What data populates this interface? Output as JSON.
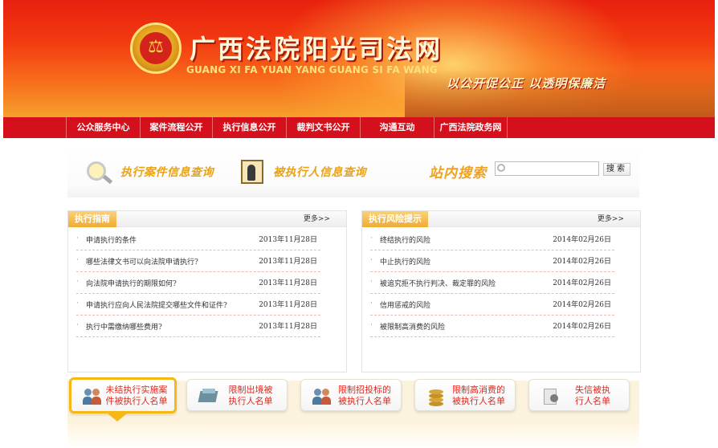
{
  "header": {
    "title": "广西法院阳光司法网",
    "pinyin": "GUANG XI FA YUAN YANG GUANG SI FA WANG",
    "slogan": "以公开促公正  以透明保廉洁"
  },
  "nav": {
    "items": [
      {
        "label": "公众服务中心"
      },
      {
        "label": "案件流程公开"
      },
      {
        "label": "执行信息公开"
      },
      {
        "label": "裁判文书公开"
      },
      {
        "label": "沟通互动"
      },
      {
        "label": "广西法院政务网"
      }
    ]
  },
  "quick_links": {
    "case_query": "执行案件信息查询",
    "person_query": "被执行人信息查询"
  },
  "search": {
    "label": "站内搜索",
    "placeholder": "",
    "button": "搜索"
  },
  "panels": {
    "guide": {
      "title": "执行指南",
      "more": "更多>>",
      "items": [
        {
          "title": "申请执行的条件",
          "date": "2013年11月28日"
        },
        {
          "title": "哪些法律文书可以向法院申请执行?",
          "date": "2013年11月28日"
        },
        {
          "title": "向法院申请执行的期限如何?",
          "date": "2013年11月28日"
        },
        {
          "title": "申请执行应向人民法院提交哪些文件和证件?",
          "date": "2013年11月28日"
        },
        {
          "title": "执行中需缴纳哪些费用?",
          "date": "2013年11月28日"
        }
      ]
    },
    "risk": {
      "title": "执行风险提示",
      "more": "更多>>",
      "items": [
        {
          "title": "终结执行的风险",
          "date": "2014年02月26日"
        },
        {
          "title": "中止执行的风险",
          "date": "2014年02月26日"
        },
        {
          "title": "被追究拒不执行判决、裁定罪的风险",
          "date": "2014年02月26日"
        },
        {
          "title": "信用惩戒的风险",
          "date": "2014年02月26日"
        },
        {
          "title": "被限制高消费的风险",
          "date": "2014年02月26日"
        }
      ]
    }
  },
  "categories": [
    {
      "line1": "未结执行实施案",
      "line2": "件被执行人名单",
      "icon": "people-icon"
    },
    {
      "line1": "限制出境被",
      "line2": "执行人名单",
      "icon": "ticket-icon"
    },
    {
      "line1": "限制招投标的",
      "line2": "被执行人名单",
      "icon": "people-icon"
    },
    {
      "line1": "限制高消费的",
      "line2": "被执行人名单",
      "icon": "coins-icon"
    },
    {
      "line1": "失信被执",
      "line2": "行人名单",
      "icon": "document-icon"
    }
  ],
  "colors": {
    "nav_red": "#d3101b",
    "tab_orange": "#efac34",
    "category_text": "#e0281e",
    "highlight_yellow": "#f5b816"
  }
}
